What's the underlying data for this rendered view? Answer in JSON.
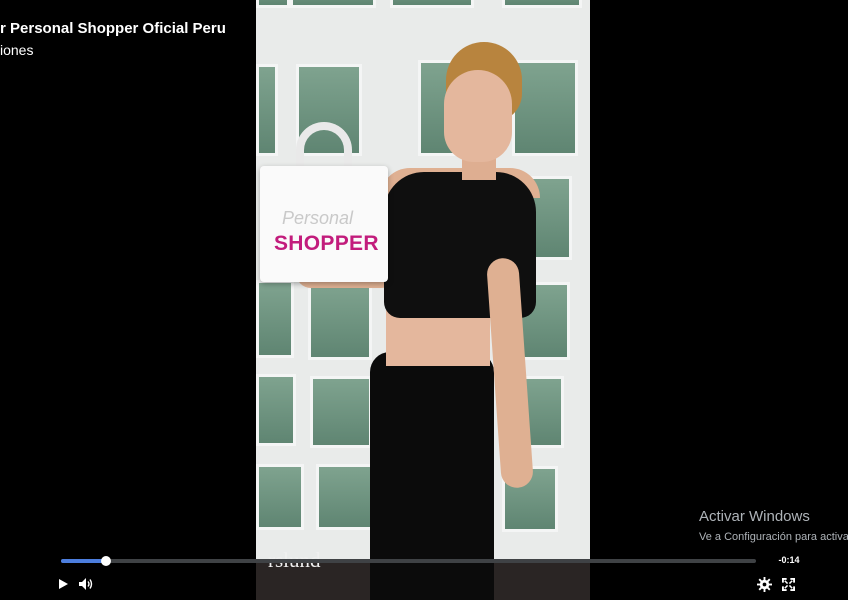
{
  "header": {
    "title": "r Personal Shopper Oficial Peru",
    "subtitle": "iones"
  },
  "video": {
    "bag_text_top": "Personal",
    "bag_text_bottom": "SHOPPER",
    "overlay_watermark": "rslund"
  },
  "player": {
    "progress": 0.065,
    "time_remaining": "-0:14",
    "accent_color": "#4c7ede",
    "controls": [
      "play-icon",
      "volume-icon",
      "gear-icon",
      "fullscreen-icon"
    ]
  },
  "windows_watermark": {
    "title": "Activar Windows",
    "subtitle": "Ve a Configuración para activar Windows."
  }
}
